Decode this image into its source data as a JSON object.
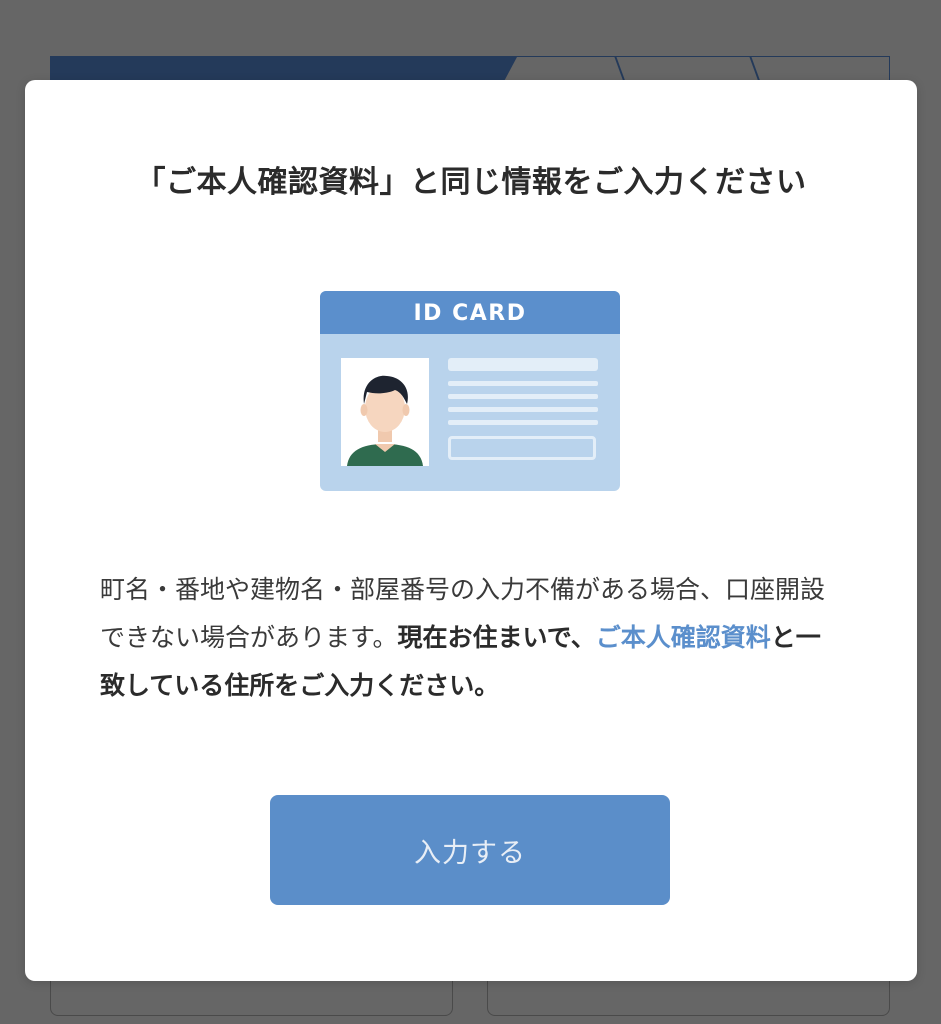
{
  "colors": {
    "overlay": "#666666",
    "modal_bg": "#ffffff",
    "accent": "#5b8ec9",
    "link": "#5b8fcc",
    "heading": "#2b2b2b",
    "progress_active": "#243a5a"
  },
  "modal": {
    "title": "「ご本人確認資料」と同じ情報をご入力ください",
    "id_card": {
      "header": "ID CARD",
      "photo_icon": "person-avatar-icon"
    },
    "body": {
      "text_plain": "町名・番地や建物名・部屋番号の入力不備がある場合、口座開設できない場合があります。",
      "text_bold_1": "現在お住まいで、",
      "text_link": "ご本人確認資料",
      "text_bold_2": "と一致している住所をご入力ください。"
    },
    "submit_label": "入力する"
  }
}
